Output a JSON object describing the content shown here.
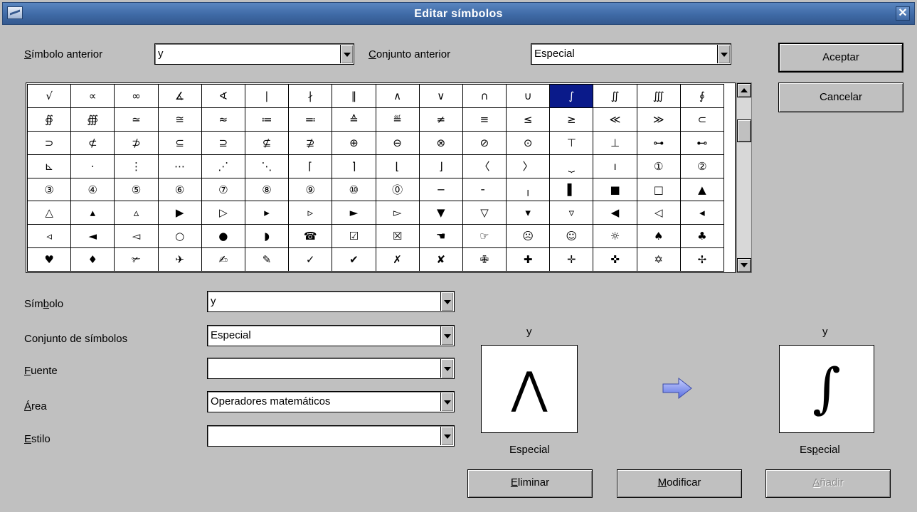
{
  "window": {
    "title": "Editar símbolos",
    "close_glyph": "✕"
  },
  "top": {
    "prev_symbol_label": {
      "pre": "",
      "u": "S",
      "post": "ímbolo anterior"
    },
    "prev_symbol_value": "y",
    "prev_set_label": {
      "pre": "",
      "u": "C",
      "post": "onjunto anterior"
    },
    "prev_set_value": "Especial"
  },
  "buttons": {
    "accept": "Aceptar",
    "cancel": "Cancelar",
    "delete": {
      "pre": "",
      "u": "E",
      "post": "liminar"
    },
    "modify": {
      "pre": "",
      "u": "M",
      "post": "odificar"
    },
    "add": {
      "pre": "",
      "u": "A",
      "post": "ñadir"
    }
  },
  "symbol_grid": [
    [
      "√",
      "∝",
      "∞",
      "∡",
      "∢",
      "∣",
      "∤",
      "∥",
      "∧",
      "∨",
      "∩",
      "∪",
      "∫",
      "∬",
      "∭",
      "∮"
    ],
    [
      "∯",
      "∰",
      "≃",
      "≅",
      "≈",
      "≔",
      "≕",
      "≙",
      "≝",
      "≠",
      "≡",
      "≤",
      "≥",
      "≪",
      "≫",
      "⊂"
    ],
    [
      "⊃",
      "⊄",
      "⊅",
      "⊆",
      "⊇",
      "⊈",
      "⊉",
      "⊕",
      "⊖",
      "⊗",
      "⊘",
      "⊙",
      "⊤",
      "⊥",
      "⊶",
      "⊷"
    ],
    [
      "⊾",
      "⋅",
      "⋮",
      "⋯",
      "⋰",
      "⋱",
      "⌈",
      "⌉",
      "⌊",
      "⌋",
      "〈",
      "〉",
      "⏟",
      "ı",
      "①",
      "②"
    ],
    [
      "③",
      "④",
      "⑤",
      "⑥",
      "⑦",
      "⑧",
      "⑨",
      "⑩",
      "⓪",
      "─",
      "╴",
      "╷",
      "▌",
      "■",
      "□",
      "▲"
    ],
    [
      "△",
      "▴",
      "▵",
      "▶",
      "▷",
      "▸",
      "▹",
      "►",
      "▻",
      "▼",
      "▽",
      "▾",
      "▿",
      "◀",
      "◁",
      "◂"
    ],
    [
      "◃",
      "◄",
      "◅",
      "○",
      "●",
      "◗",
      "☎",
      "☑",
      "☒",
      "☚",
      "☞",
      "☹",
      "☺",
      "☼",
      "♠",
      "♣"
    ],
    [
      "♥",
      "♦",
      "✃",
      "✈",
      "✍",
      "✎",
      "✓",
      "✔",
      "✗",
      "✘",
      "✙",
      "✚",
      "✛",
      "✜",
      "✡",
      "✢"
    ]
  ],
  "selected_cell": {
    "row": 0,
    "col": 12
  },
  "form": {
    "symbol_label": {
      "pre": "Sím",
      "u": "b",
      "post": "olo"
    },
    "symbol_value": "y",
    "set_label": {
      "pre": "Conjunto de símbolos",
      "u": "",
      "post": ""
    },
    "set_value": "Especial",
    "font_label": {
      "pre": "",
      "u": "F",
      "post": "uente"
    },
    "font_value": "",
    "area_label": {
      "pre": "",
      "u": "Á",
      "post": "rea"
    },
    "area_value": "Operadores matemáticos",
    "style_label": {
      "pre": "",
      "u": "E",
      "post": "stilo"
    },
    "style_value": ""
  },
  "preview_old": {
    "name": "y",
    "glyph": "⋀",
    "set": {
      "pre": "Especial",
      "u": "",
      "post": ""
    }
  },
  "preview_new": {
    "name": "y",
    "glyph": "∫",
    "set": {
      "pre": "Es",
      "u": "p",
      "post": "ecial"
    }
  },
  "colors": {
    "selection": "#0a1a8a",
    "title_bar": "#4570ab",
    "arrow": "#7f92f0"
  },
  "icons": {
    "arrow": "right-arrow-icon"
  }
}
